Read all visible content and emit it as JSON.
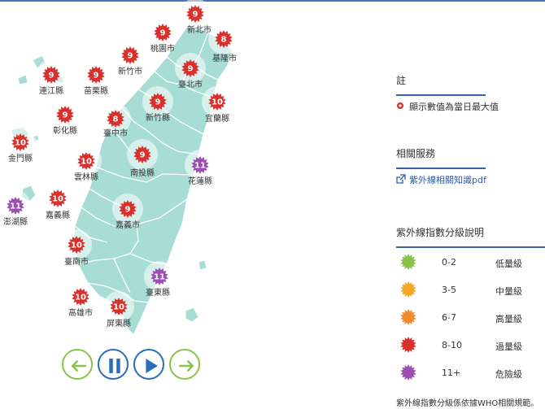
{
  "colors": {
    "low": "#8bc34a",
    "moderate": "#f5a623",
    "high": "#ef8a2e",
    "very_high": "#d9302c",
    "extreme": "#9c4fb0",
    "land": "#a8ddd5",
    "land_stroke": "#ffffff",
    "accent": "#3a5fa5"
  },
  "badges": [
    {
      "name": "新北市",
      "value": "9",
      "level": "very_high"
    },
    {
      "name": "桃園市",
      "value": "9",
      "level": "very_high"
    },
    {
      "name": "基隆市",
      "value": "8",
      "level": "very_high"
    },
    {
      "name": "新竹市",
      "value": "9",
      "level": "very_high"
    },
    {
      "name": "臺北市",
      "value": "9",
      "level": "very_high"
    },
    {
      "name": "連江縣",
      "value": "9",
      "level": "very_high"
    },
    {
      "name": "苗栗縣",
      "value": "9",
      "level": "very_high"
    },
    {
      "name": "新竹縣",
      "value": "9",
      "level": "very_high"
    },
    {
      "name": "宜蘭縣",
      "value": "10",
      "level": "very_high"
    },
    {
      "name": "彰化縣",
      "value": "9",
      "level": "very_high"
    },
    {
      "name": "臺中市",
      "value": "8",
      "level": "very_high"
    },
    {
      "name": "金門縣",
      "value": "10",
      "level": "very_high"
    },
    {
      "name": "南投縣",
      "value": "9",
      "level": "very_high"
    },
    {
      "name": "雲林縣",
      "value": "10",
      "level": "very_high"
    },
    {
      "name": "花蓮縣",
      "value": "11",
      "level": "extreme"
    },
    {
      "name": "澎湖縣",
      "value": "11",
      "level": "extreme"
    },
    {
      "name": "嘉義縣",
      "value": "10",
      "level": "very_high"
    },
    {
      "name": "嘉義市",
      "value": "9",
      "level": "very_high"
    },
    {
      "name": "臺南市",
      "value": "10",
      "level": "very_high"
    },
    {
      "name": "臺東縣",
      "value": "11",
      "level": "extreme"
    },
    {
      "name": "高雄市",
      "value": "10",
      "level": "very_high"
    },
    {
      "name": "屏東縣",
      "value": "10",
      "level": "very_high"
    }
  ],
  "controls": [
    {
      "name": "prev-button",
      "icon": "arrow-left-icon",
      "color": "#8bc34a"
    },
    {
      "name": "pause-button",
      "icon": "pause-icon",
      "color": "#2a6db8"
    },
    {
      "name": "play-button",
      "icon": "play-icon",
      "color": "#2a6db8"
    },
    {
      "name": "next-button",
      "icon": "arrow-right-icon",
      "color": "#8bc34a"
    }
  ],
  "panel": {
    "note_title": "註",
    "note_text": "顯示數值為當日最大值",
    "services_title": "相關服務",
    "services_link": "紫外線相關知識pdf",
    "legend_title": "紫外線指數分級說明",
    "legend": [
      {
        "range": "0-2",
        "label": "低量級",
        "level": "low"
      },
      {
        "range": "3-5",
        "label": "中量級",
        "level": "moderate"
      },
      {
        "range": "6-7",
        "label": "高量級",
        "level": "high"
      },
      {
        "range": "8-10",
        "label": "過量級",
        "level": "very_high"
      },
      {
        "range": "11+",
        "label": "危險級",
        "level": "extreme"
      }
    ],
    "footer": "紫外線指數分級係依據WHO相關規範。"
  }
}
